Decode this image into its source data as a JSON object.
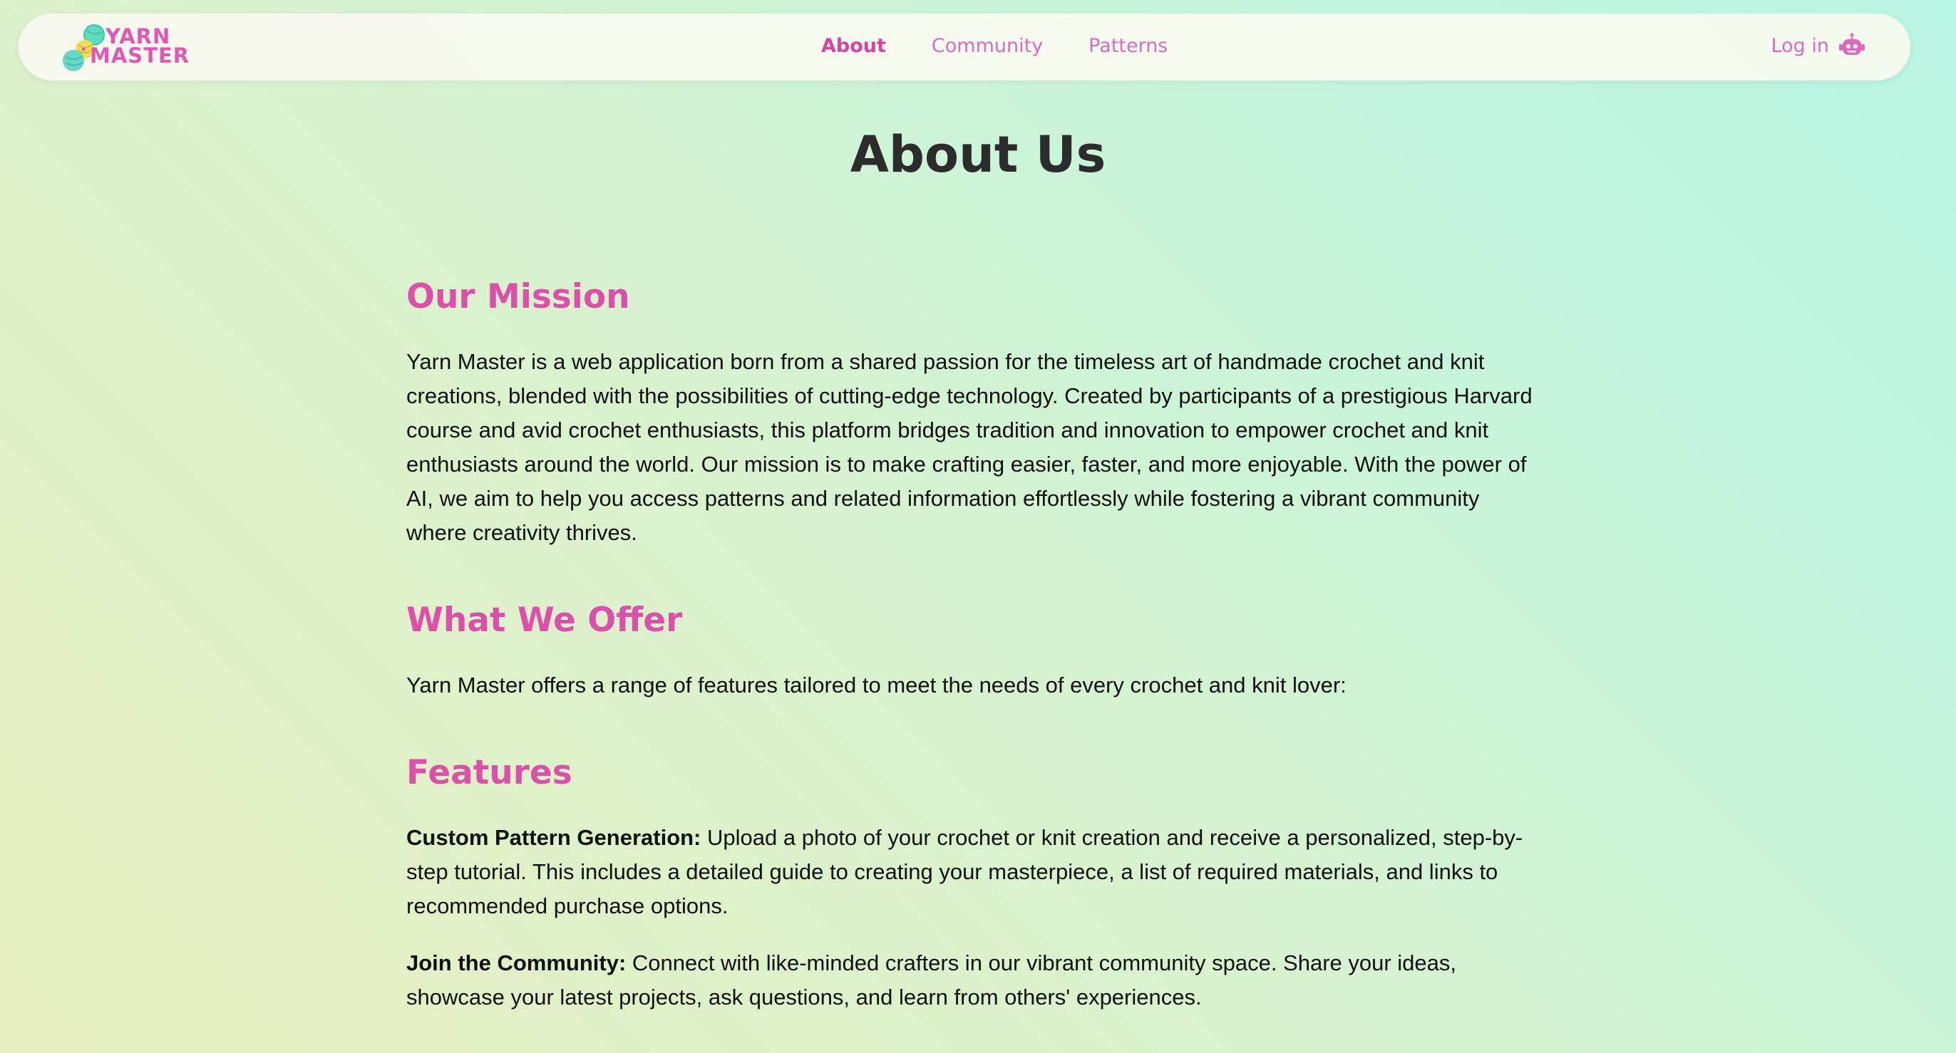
{
  "brand": {
    "line1": "YARN",
    "line2": "MASTER",
    "accent_color": "#dc4fab"
  },
  "nav": {
    "items": [
      {
        "label": "About",
        "active": true
      },
      {
        "label": "Community",
        "active": false
      },
      {
        "label": "Patterns",
        "active": false
      }
    ],
    "login_label": "Log in",
    "login_icon": "robot-icon"
  },
  "page": {
    "title": "About Us"
  },
  "sections": {
    "mission": {
      "heading": "Our Mission",
      "text": "Yarn Master is a web application born from a shared passion for the timeless art of handmade crochet and knit creations, blended with the possibilities of cutting-edge technology. Created by participants of a prestigious Harvard course and avid crochet enthusiasts, this platform bridges tradition and innovation to empower crochet and knit enthusiasts around the world. Our mission is to make crafting easier, faster, and more enjoyable. With the power of AI, we aim to help you access patterns and related information effortlessly while fostering a vibrant community where creativity thrives."
    },
    "offer": {
      "heading": "What We Offer",
      "text": "Yarn Master offers a range of features tailored to meet the needs of every crochet and knit lover:"
    },
    "features": {
      "heading": "Features",
      "items": [
        {
          "label": "Custom Pattern Generation:",
          "text": " Upload a photo of your crochet or knit creation and receive a personalized, step-by-step tutorial. This includes a detailed guide to creating your masterpiece, a list of required materials, and links to recommended purchase options."
        },
        {
          "label": "Join the Community:",
          "text": " Connect with like-minded crafters in our vibrant community space. Share your ideas, showcase your latest projects, ask questions, and learn from others' experiences."
        }
      ]
    }
  }
}
